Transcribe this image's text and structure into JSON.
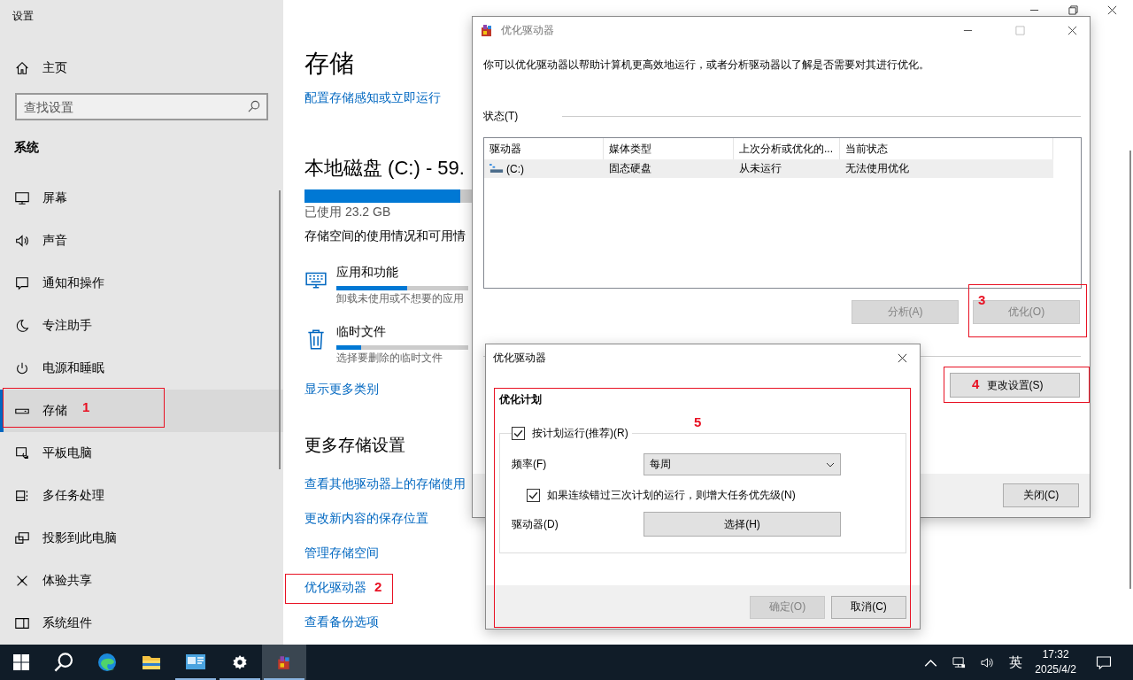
{
  "settings": {
    "window_title": "设置",
    "home": "主页",
    "search": {
      "placeholder": "查找设置"
    },
    "section": "系统",
    "nav": [
      {
        "label": "屏幕",
        "selected": false
      },
      {
        "label": "声音",
        "selected": false
      },
      {
        "label": "通知和操作",
        "selected": false
      },
      {
        "label": "专注助手",
        "selected": false
      },
      {
        "label": "电源和睡眠",
        "selected": false
      },
      {
        "label": "存储",
        "selected": true
      },
      {
        "label": "平板电脑",
        "selected": false
      },
      {
        "label": "多任务处理",
        "selected": false
      },
      {
        "label": "投影到此电脑",
        "selected": false
      },
      {
        "label": "体验共享",
        "selected": false
      },
      {
        "label": "系统组件",
        "selected": false
      }
    ],
    "page_title": "存储",
    "sense_link": "配置存储感知或立即运行",
    "disk": {
      "title": "本地磁盘 (C:) - 59.",
      "level": 0.93,
      "used": "已使用 23.2 GB"
    },
    "usage_intro": "存储空间的使用情况和可用情",
    "categories": [
      {
        "name": "应用和功能",
        "level": 0.54,
        "description": "卸载未使用或不想要的应用"
      },
      {
        "name": "临时文件",
        "level": 0.19,
        "description": "选择要删除的临时文件"
      }
    ],
    "show_more": "显示更多类别",
    "more_heading": "更多存储设置",
    "links": [
      "查看其他驱动器上的存储使用",
      "更改新内容的保存位置",
      "管理存储空间",
      "优化驱动器",
      "查看备份选项"
    ]
  },
  "optimize_dialog": {
    "title": "优化驱动器",
    "description": "你可以优化驱动器以帮助计算机更高效地运行，或者分析驱动器以了解是否需要对其进行优化。",
    "status_label": "状态(T)",
    "table": {
      "columns": [
        "驱动器",
        "媒体类型",
        "上次分析或优化的...",
        "当前状态"
      ],
      "rows": [
        {
          "cells": [
            "(C:)",
            "固态硬盘",
            "从未运行",
            "无法使用优化"
          ],
          "selected": true
        }
      ]
    },
    "buttons": [
      {
        "label": "分析(A)",
        "disabled": true
      },
      {
        "label": "优化(O)",
        "disabled": true
      }
    ],
    "settings_button": "更改设置(S)",
    "close_button": "关闭(C)"
  },
  "schedule_dialog": {
    "title": "优化驱动器",
    "heading": "优化计划",
    "run_on_schedule": {
      "label": "按计划运行(推荐)(R)",
      "checked": true
    },
    "frequency_label": "频率(F)",
    "frequency": {
      "value": "每周"
    },
    "priority": {
      "label": "如果连续错过三次计划的运行，则增大任务优先级(N)",
      "checked": true
    },
    "drives_label": "驱动器(D)",
    "choose_button": "选择(H)",
    "ok": {
      "label": "确定(O)",
      "disabled": true
    },
    "cancel": {
      "label": "取消(C)",
      "disabled": false
    }
  },
  "annotations": [
    "1",
    "2",
    "3",
    "4",
    "5"
  ],
  "taskbar": {
    "apps": [
      {
        "running": false,
        "selected": false
      },
      {
        "running": false,
        "selected": false
      },
      {
        "running": true,
        "selected": false
      },
      {
        "running": true,
        "selected": false
      },
      {
        "running": true,
        "selected": true
      }
    ],
    "language": "英",
    "time": "17:32",
    "date": "2025/4/2"
  }
}
